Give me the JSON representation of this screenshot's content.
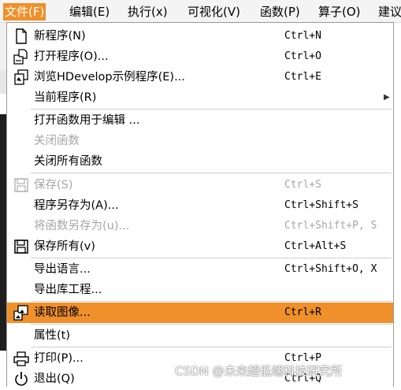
{
  "menubar": {
    "items": [
      {
        "label": "文件(F)"
      },
      {
        "label": "编辑(E)"
      },
      {
        "label": "执行(x)"
      },
      {
        "label": "可视化(V)"
      },
      {
        "label": "函数(P)"
      },
      {
        "label": "算子(O)"
      },
      {
        "label": "建议"
      }
    ]
  },
  "menu": {
    "items": [
      {
        "label": "新程序(N)",
        "shortcut": "Ctrl+N",
        "icon": "new-document-icon"
      },
      {
        "label": "打开程序(O)...",
        "shortcut": "Ctrl+O",
        "icon": "open-folder-icon"
      },
      {
        "label": "浏览HDevelop示例程序(E)...",
        "shortcut": "Ctrl+E",
        "icon": "browse-examples-icon"
      },
      {
        "label": "当前程序(R)",
        "shortcut": "",
        "icon": ""
      },
      {
        "label": "打开函数用于编辑 ...",
        "shortcut": "",
        "icon": ""
      },
      {
        "label": "关闭函数",
        "shortcut": "",
        "icon": ""
      },
      {
        "label": "关闭所有函数",
        "shortcut": "",
        "icon": ""
      },
      {
        "label": "保存(S)",
        "shortcut": "Ctrl+S",
        "icon": "save-icon"
      },
      {
        "label": "程序另存为(A)...",
        "shortcut": "Ctrl+Shift+S",
        "icon": ""
      },
      {
        "label": "将函数另存为(u)...",
        "shortcut": "Ctrl+Shift+P, S",
        "icon": ""
      },
      {
        "label": "保存所有(v)",
        "shortcut": "Ctrl+Alt+S",
        "icon": "save-all-icon"
      },
      {
        "label": "导出语言...",
        "shortcut": "Ctrl+Shift+O, X",
        "icon": ""
      },
      {
        "label": "导出库工程...",
        "shortcut": "",
        "icon": ""
      },
      {
        "label": "读取图像...",
        "shortcut": "Ctrl+R",
        "icon": "read-image-icon"
      },
      {
        "label": "属性(t)",
        "shortcut": "",
        "icon": ""
      },
      {
        "label": "打印(P)...",
        "shortcut": "Ctrl+P",
        "icon": "print-icon"
      },
      {
        "label": "退出(Q)",
        "shortcut": "Ctrl+Q",
        "icon": "power-icon"
      }
    ]
  },
  "watermark": "CSDN @未来超低端科技研究所",
  "colors": {
    "highlight": "#f0902a",
    "disabled": "#a6a6a6"
  }
}
